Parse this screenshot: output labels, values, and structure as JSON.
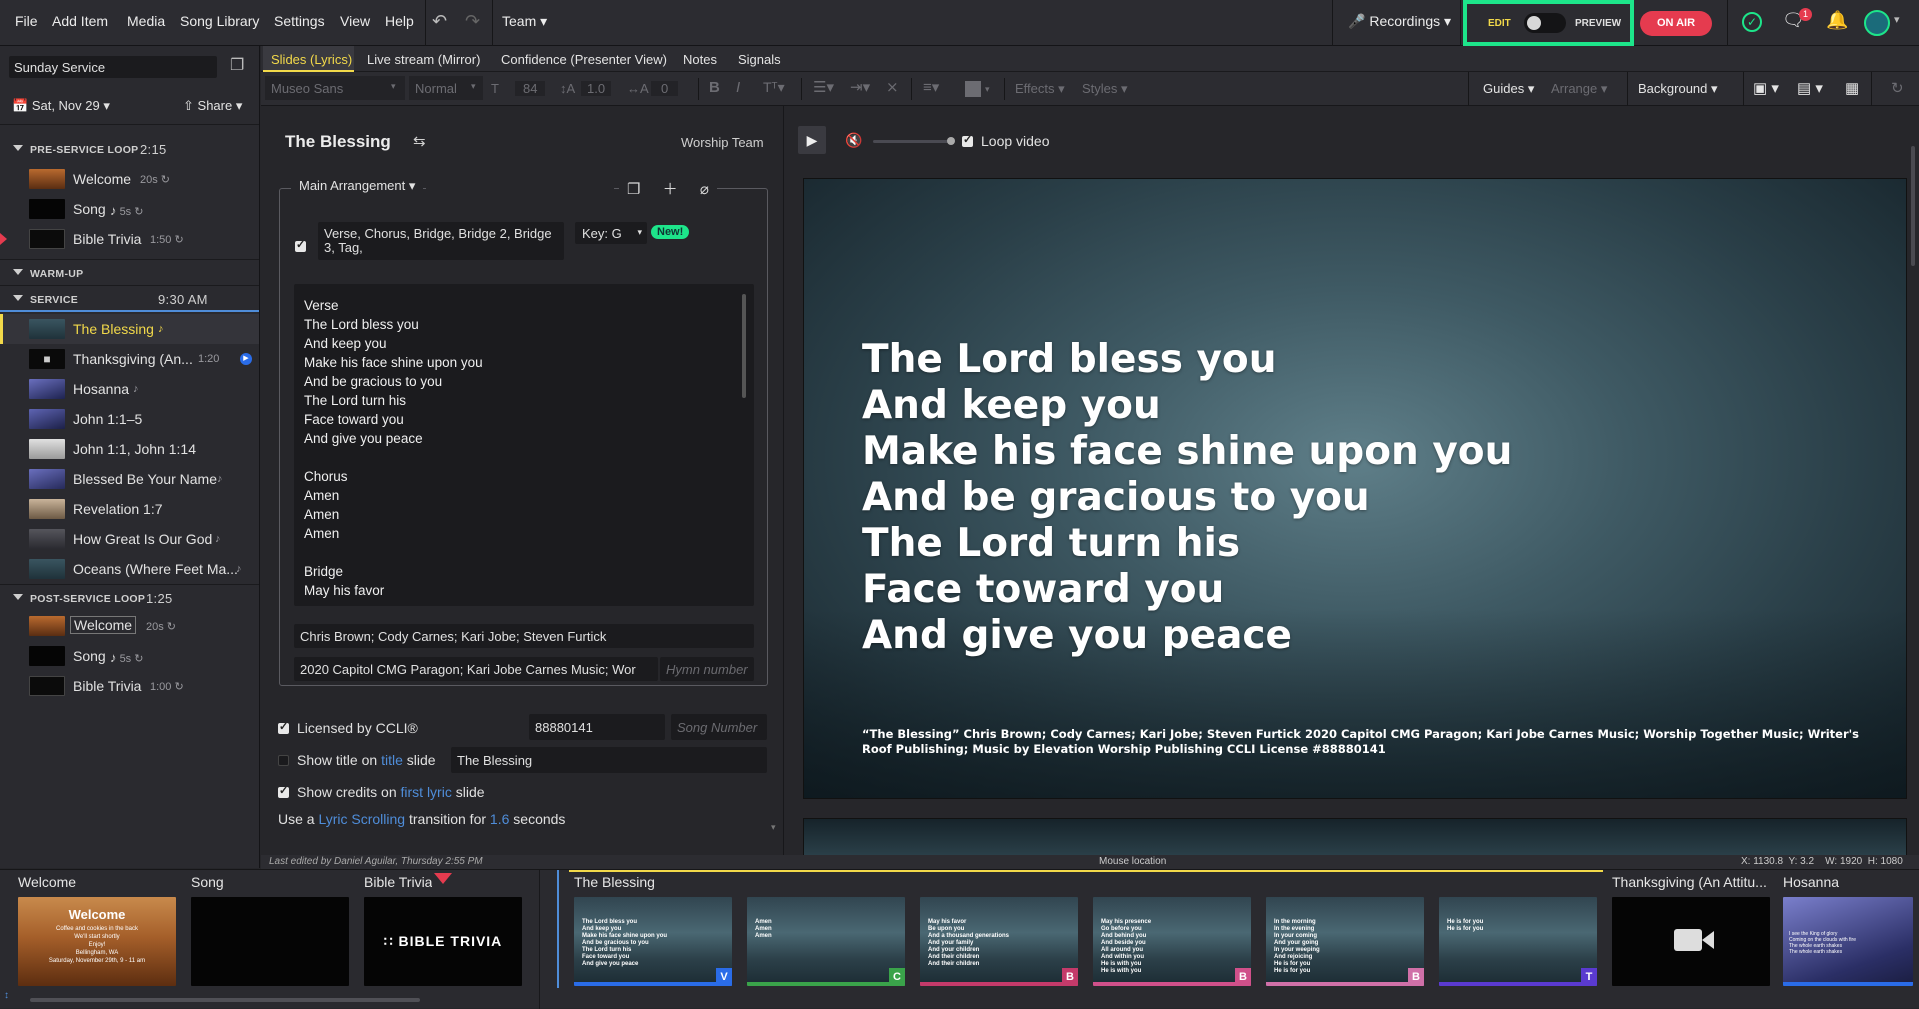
{
  "menu": [
    "File",
    "Add Item",
    "Media",
    "Song Library",
    "Settings",
    "View",
    "Help"
  ],
  "team_label": "Team",
  "recordings_label": "Recordings",
  "edit_label": "EDIT",
  "preview_label": "PREVIEW",
  "on_air_label": "ON AIR",
  "notification_count": "1",
  "colors": {
    "accent": "#1de58a",
    "on_air": "#e53b4f",
    "active_item": "#f2d94a",
    "link": "#4f8dd9"
  },
  "sidebar": {
    "service_name": "Sunday Service",
    "date": "Sat, Nov 29",
    "share": "Share",
    "sections": [
      {
        "label": "PRE-SERVICE LOOP",
        "time": "2:15",
        "items": [
          {
            "name": "Welcome",
            "meta": "20s"
          },
          {
            "name": "Song",
            "meta": "5s"
          },
          {
            "name": "Bible Trivia",
            "meta": "1:50"
          }
        ]
      },
      {
        "label": "WARM-UP",
        "time": "",
        "items": []
      },
      {
        "label": "SERVICE",
        "time": "9:30 AM",
        "items": [
          {
            "name": "The Blessing",
            "meta": ""
          },
          {
            "name": "Thanksgiving (An...",
            "meta": "1:20"
          },
          {
            "name": "Hosanna",
            "meta": ""
          },
          {
            "name": "John 1:1–5",
            "meta": ""
          },
          {
            "name": "John 1:1, John 1:14",
            "meta": ""
          },
          {
            "name": "Blessed Be Your Name",
            "meta": ""
          },
          {
            "name": "Revelation 1:7",
            "meta": ""
          },
          {
            "name": "How Great Is Our God",
            "meta": ""
          },
          {
            "name": "Oceans (Where Feet Ma...",
            "meta": ""
          }
        ]
      },
      {
        "label": "POST-SERVICE LOOP",
        "time": "1:25",
        "items": [
          {
            "name": "Welcome",
            "meta": "20s"
          },
          {
            "name": "Song",
            "meta": "5s"
          },
          {
            "name": "Bible Trivia",
            "meta": "1:00"
          }
        ]
      }
    ]
  },
  "tabs": [
    "Slides (Lyrics)",
    "Live stream (Mirror)",
    "Confidence (Presenter View)",
    "Notes",
    "Signals"
  ],
  "toolbar": {
    "font": "Museo Sans",
    "weight": "Normal",
    "size": "84",
    "line": "1.0",
    "spacing": "0",
    "effects": "Effects",
    "styles": "Styles",
    "guides": "Guides",
    "arrange": "Arrange",
    "background": "Background"
  },
  "editor": {
    "title": "The Blessing",
    "team": "Worship Team",
    "arrangement": "Main Arrangement",
    "order": "Verse, Chorus, Bridge, Bridge 2, Bridge 3, Tag,",
    "key": "Key: G",
    "new_badge": "New!",
    "lyrics": "Verse\nThe Lord bless you\nAnd keep you\nMake his face shine upon you\nAnd be gracious to you\nThe Lord turn his\nFace toward you\nAnd give you peace\n\nChorus\nAmen\nAmen\nAmen\n\nBridge\nMay his favor",
    "authors": "Chris Brown; Cody Carnes; Kari Jobe; Steven Furtick",
    "copyright": "2020 Capitol CMG Paragon; Kari Jobe Carnes Music; Wor",
    "hymn_placeholder": "Hymn number",
    "ccli_label": "Licensed by CCLI®",
    "ccli_number": "88880141",
    "song_number_placeholder": "Song Number",
    "show_title_a": "Show title on",
    "show_title_link": "title",
    "show_title_b": "slide",
    "title_value": "The Blessing",
    "show_credits_a": "Show credits on",
    "show_credits_link": "first lyric",
    "show_credits_b": "slide",
    "transition_a": "Use a",
    "transition_link": "Lyric Scrolling",
    "transition_b": "transition for",
    "transition_secs": "1.6",
    "transition_c": "seconds"
  },
  "preview": {
    "loop_label": "Loop video",
    "lyrics": [
      "The Lord bless you",
      "And keep you",
      "Make his face shine upon you",
      "And be gracious to you",
      "The Lord turn his",
      "Face toward you",
      "And give you peace"
    ],
    "credits": "“The Blessing” Chris Brown; Cody Carnes; Kari Jobe; Steven Furtick 2020 Capitol CMG Paragon; Kari Jobe Carnes Music; Worship Together Music; Writer's Roof Publishing; Music by Elevation Worship Publishing CCLI License #88880141"
  },
  "status": {
    "edited": "Last edited by Daniel Aguilar, Thursday 2:55 PM",
    "mouse": "Mouse location",
    "coords": "X: 1130.8  Y: 3.2    W: 1920  H: 1080"
  },
  "filmstrip": {
    "pre": [
      {
        "label": "Welcome",
        "thumb_title": "Welcome",
        "thumb_sub": "Coffee and cookies in the back\nWe'll start shortly\nEnjoy!\nBellingham, WA\nSaturday, November 29th, 9 - 11 am"
      },
      {
        "label": "Song"
      },
      {
        "label": "Bible Trivia",
        "thumb_title": "BIBLE TRIVIA"
      }
    ],
    "current_label": "The Blessing",
    "slides": [
      {
        "text": "The Lord bless you\nAnd keep you\nMake his face shine upon you\nAnd be gracious to you\nThe Lord turn his\nFace toward you\nAnd give you peace",
        "badge": "V",
        "color": "#2a6ce8"
      },
      {
        "text": "Amen\nAmen\nAmen",
        "badge": "C",
        "color": "#3aa34a"
      },
      {
        "text": "May his favor\nBe upon you\nAnd a thousand generations\nAnd your family\nAnd your children\nAnd their children\nAnd their children",
        "badge": "B",
        "color": "#c43a6a"
      },
      {
        "text": "May his presence\nGo before you\nAnd behind you\nAnd beside you\nAll around you\nAnd within you\nHe is with you\nHe is with you",
        "badge": "B",
        "color": "#d0508a"
      },
      {
        "text": "In the morning\nIn the evening\nIn your coming\nAnd your going\nIn your weeping\nAnd rejoicing\nHe is for you\nHe is for you",
        "badge": "B",
        "color": "#d070a8"
      },
      {
        "text": "He is for you\nHe is for you",
        "badge": "T",
        "color": "#5a3ad0"
      }
    ],
    "next": [
      {
        "label": "Thanksgiving (An Attitu..."
      },
      {
        "label": "Hosanna",
        "thumb_text": "I see the King of glory\nComing on the clouds with fire\nThe whole earth shakes\nThe whole earth shakes"
      }
    ]
  }
}
